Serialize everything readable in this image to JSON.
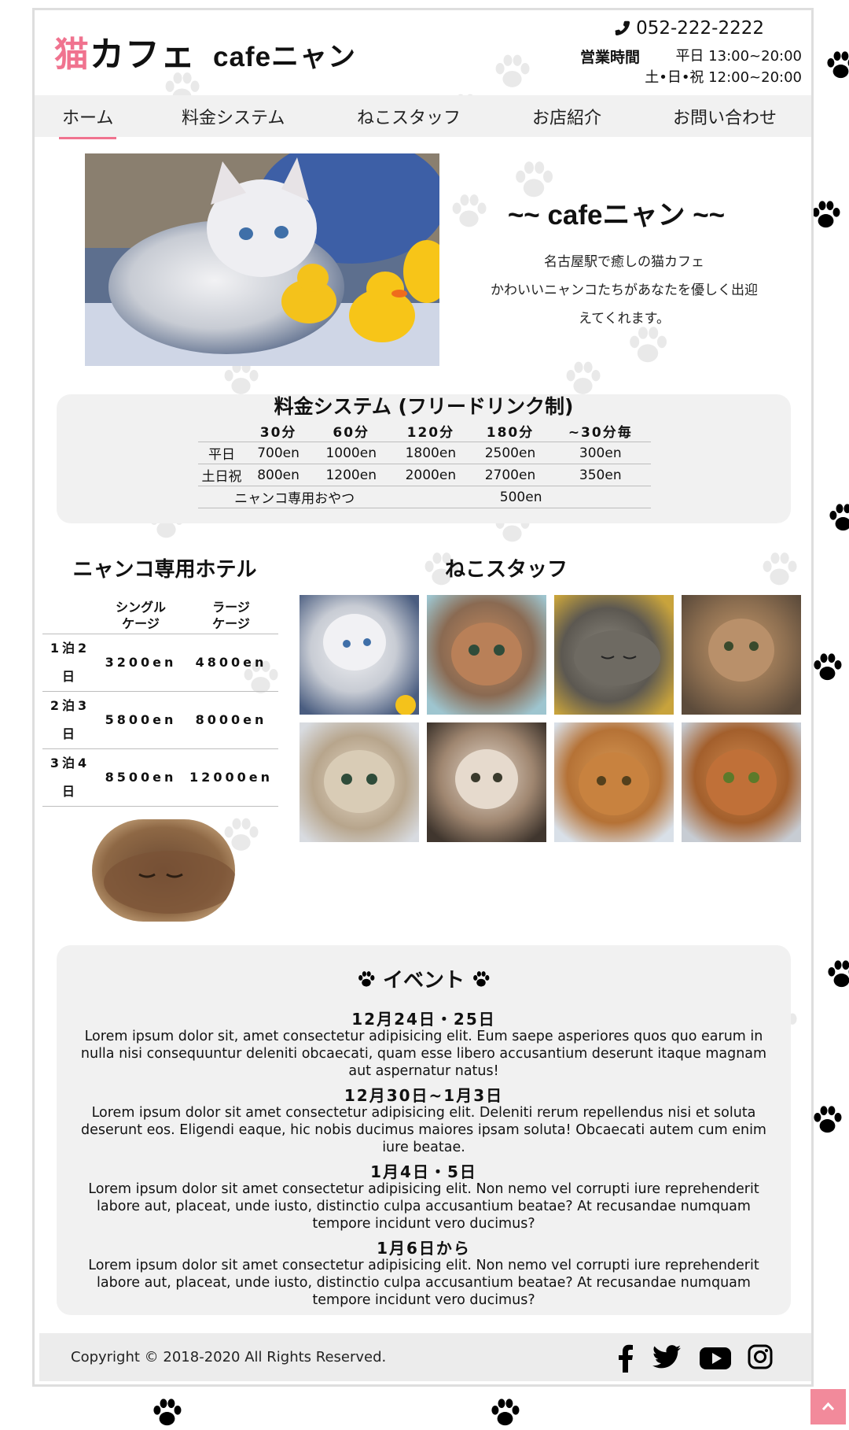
{
  "colors": {
    "accent": "#f0738f",
    "panel": "#f1f1f1",
    "to_top": "#f28a9b"
  },
  "header": {
    "logo_accent": "猫",
    "logo_main": "カフェ",
    "logo_sub": "cafeニャン",
    "phone": "052-222-2222",
    "hours_label": "営業時間",
    "hours_weekday": "平日 13:00~20:00",
    "hours_holiday": "土•日•祝 12:00~20:00"
  },
  "nav": {
    "items": [
      "ホーム",
      "料金システム",
      "ねこスタッフ",
      "お店紹介",
      "お問い合わせ"
    ],
    "active": "ホーム"
  },
  "hero": {
    "title": "~~ cafeニャン ~~",
    "line1": "名古屋駅で癒しの猫カフェ",
    "line2": "かわいいニャンコたちがあなたを優しく出迎",
    "line3": "えてくれます。"
  },
  "pricing": {
    "title": "料金システム (フリードリンク制)",
    "headers": [
      "30分",
      "60分",
      "120分",
      "180分",
      "~30分毎"
    ],
    "rows": [
      {
        "label": "平日",
        "values": [
          "700en",
          "1000en",
          "1800en",
          "2500en",
          "300en"
        ]
      },
      {
        "label": "土日祝",
        "values": [
          "800en",
          "1200en",
          "2000en",
          "2700en",
          "350en"
        ]
      }
    ],
    "snack": {
      "label": "ニャンコ専用おやつ",
      "price": "500en"
    }
  },
  "hotel": {
    "title": "ニャンコ専用ホテル",
    "headers": [
      "シングル\nケージ",
      "ラージ\nケージ"
    ],
    "rows": [
      {
        "label": "1泊2日",
        "single": "3200en",
        "large": "4800en"
      },
      {
        "label": "2泊3日",
        "single": "5800en",
        "large": "8000en"
      },
      {
        "label": "3泊4日",
        "single": "8500en",
        "large": "12000en"
      }
    ]
  },
  "staff": {
    "title": "ねこスタッフ"
  },
  "events": {
    "title": "イベント",
    "items": [
      {
        "date": "12月24日・25日",
        "text": "Lorem ipsum dolor sit, amet consectetur adipisicing elit. Eum saepe asperiores quos quo earum in nulla nisi consequuntur deleniti obcaecati, quam esse libero accusantium deserunt itaque magnam aut aspernatur natus!"
      },
      {
        "date": "12月30日~1月3日",
        "text": "Lorem ipsum dolor sit amet consectetur adipisicing elit. Deleniti rerum repellendus nisi et soluta deserunt eos. Eligendi eaque, hic nobis ducimus maiores ipsam soluta! Obcaecati autem cum enim iure beatae."
      },
      {
        "date": "1月4日・5日",
        "text": "Lorem ipsum dolor sit amet consectetur adipisicing elit. Non nemo vel corrupti iure reprehenderit labore aut, placeat, unde iusto, distinctio culpa accusantium beatae? At recusandae numquam tempore incidunt vero ducimus?"
      },
      {
        "date": "1月6日から",
        "text": "Lorem ipsum dolor sit amet consectetur adipisicing elit. Non nemo vel corrupti iure reprehenderit labore aut, placeat, unde iusto, distinctio culpa accusantium beatae? At recusandae numquam tempore incidunt vero ducimus?"
      }
    ]
  },
  "footer": {
    "copyright": "Copyright © 2018-2020 All Rights Reserved.",
    "social": [
      "facebook-icon",
      "twitter-icon",
      "youtube-icon",
      "instagram-icon"
    ]
  },
  "to_top_icon": "chevron-up-icon"
}
